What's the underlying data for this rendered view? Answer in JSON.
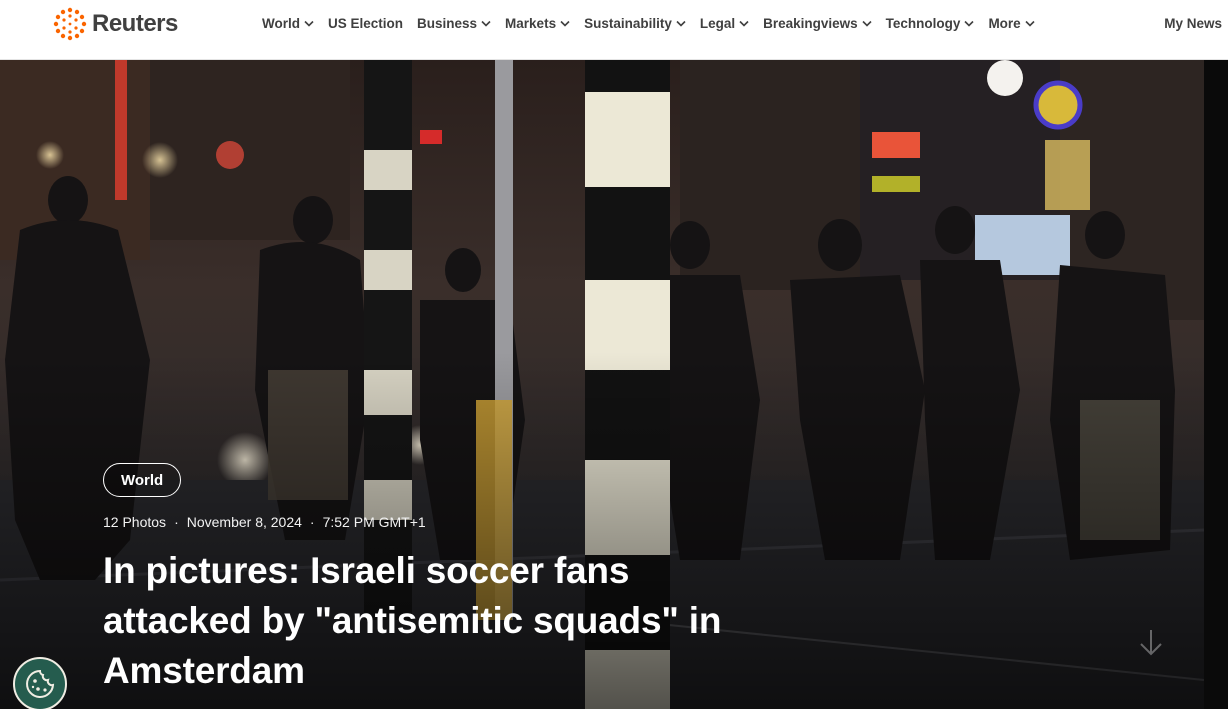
{
  "header": {
    "logo_text": "Reuters",
    "nav": [
      {
        "label": "World",
        "has_menu": true
      },
      {
        "label": "US Election",
        "has_menu": false
      },
      {
        "label": "Business",
        "has_menu": true
      },
      {
        "label": "Markets",
        "has_menu": true
      },
      {
        "label": "Sustainability",
        "has_menu": true
      },
      {
        "label": "Legal",
        "has_menu": true
      },
      {
        "label": "Breakingviews",
        "has_menu": true
      },
      {
        "label": "Technology",
        "has_menu": true
      },
      {
        "label": "More",
        "has_menu": true
      }
    ],
    "my_news": "My News"
  },
  "hero": {
    "tag": "World",
    "photo_count": "12 Photos",
    "date": "November 8, 2024",
    "time": "7:52 PM GMT+1",
    "headline": "In pictures: Israeli soccer fans attacked by \"antisemitic squads\" in Amsterdam"
  },
  "icons": {
    "logo": "reuters-logo-icon",
    "chevron": "chevron-down-icon",
    "cookie": "cookie-icon",
    "scroll_down": "arrow-down-icon"
  },
  "colors": {
    "logo_orange": "#fa6400",
    "text_dark": "#404040",
    "cookie_green": "#255c4e"
  }
}
